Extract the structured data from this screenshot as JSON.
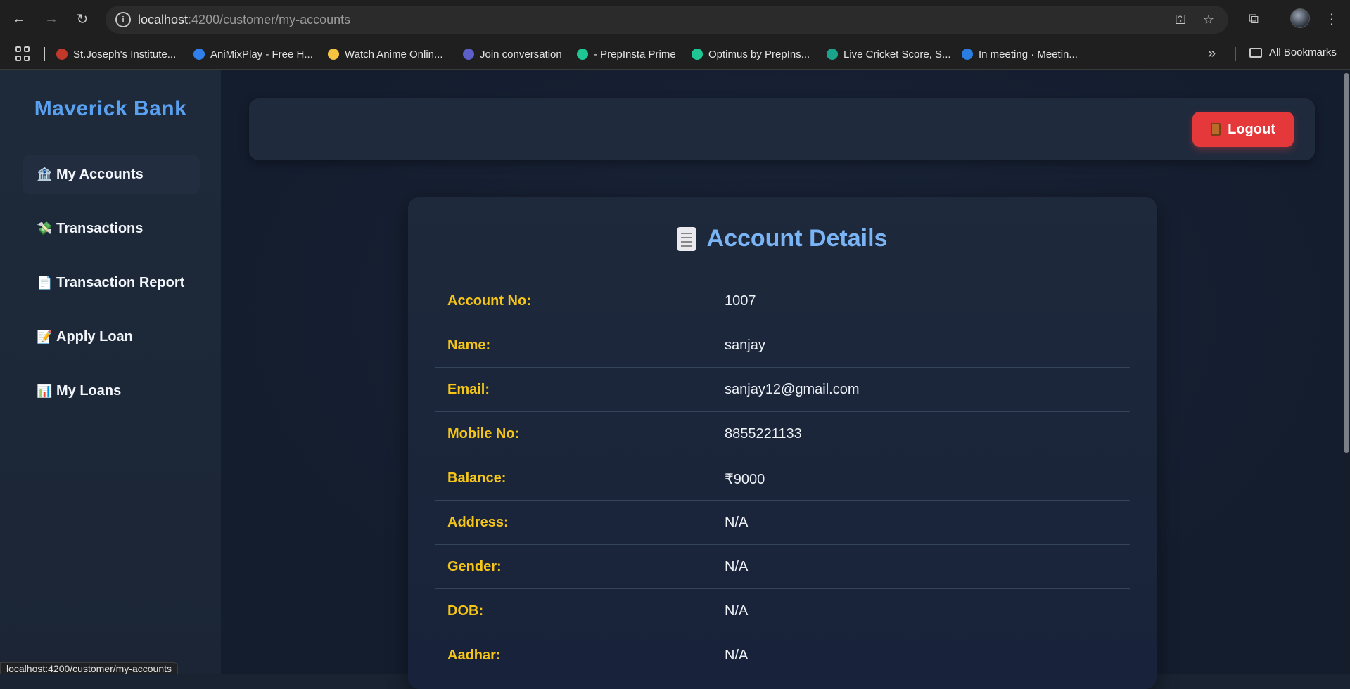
{
  "browser": {
    "url_host": "localhost",
    "url_path": ":4200/customer/my-accounts",
    "status_url": "localhost:4200/customer/my-accounts",
    "bookmarks": [
      {
        "label": "St.Joseph's Institute...",
        "icon": "stjosephs-favicon",
        "color": "#c0392b"
      },
      {
        "label": "AniMixPlay - Free H...",
        "icon": "animixplay-favicon",
        "color": "#2f80ed"
      },
      {
        "label": "Watch Anime Onlin...",
        "icon": "anime-favicon",
        "color": "#f5c542"
      },
      {
        "label": "Join conversation",
        "icon": "teams-favicon",
        "color": "#5b5fc7"
      },
      {
        "label": "- PrepInsta Prime",
        "icon": "prepinsta-favicon",
        "color": "#1fc794"
      },
      {
        "label": "Optimus by PrepIns...",
        "icon": "optimus-favicon",
        "color": "#1fc794"
      },
      {
        "label": "Live Cricket Score, S...",
        "icon": "cricbuzz-favicon",
        "color": "#1aa38a"
      },
      {
        "label": "In meeting · Meetin...",
        "icon": "webex-favicon",
        "color": "#2a7de1"
      }
    ],
    "all_bookmarks_label": "All Bookmarks"
  },
  "sidebar": {
    "brand": "Maverick Bank",
    "items": [
      {
        "emoji": "🏦",
        "label": "My Accounts",
        "active": true
      },
      {
        "emoji": "💸",
        "label": "Transactions",
        "active": false
      },
      {
        "emoji": "📄",
        "label": "Transaction Report",
        "active": false
      },
      {
        "emoji": "📝",
        "label": "Apply Loan",
        "active": false
      },
      {
        "emoji": "📊",
        "label": "My Loans",
        "active": false
      }
    ]
  },
  "header": {
    "logout_label": "Logout"
  },
  "account": {
    "title": "Account Details",
    "fields": [
      {
        "label": "Account No:",
        "value": "1007"
      },
      {
        "label": "Name:",
        "value": "sanjay"
      },
      {
        "label": "Email:",
        "value": "sanjay12@gmail.com"
      },
      {
        "label": "Mobile No:",
        "value": "8855221133"
      },
      {
        "label": "Balance:",
        "value": "₹9000"
      },
      {
        "label": "Address:",
        "value": "N/A"
      },
      {
        "label": "Gender:",
        "value": "N/A"
      },
      {
        "label": "DOB:",
        "value": "N/A"
      },
      {
        "label": "Aadhar:",
        "value": "N/A"
      }
    ]
  },
  "colors": {
    "brand": "#5aa0f0",
    "label_gold": "#f5c518",
    "logout_red": "#e5383b",
    "title_blue": "#7ab4f5"
  }
}
